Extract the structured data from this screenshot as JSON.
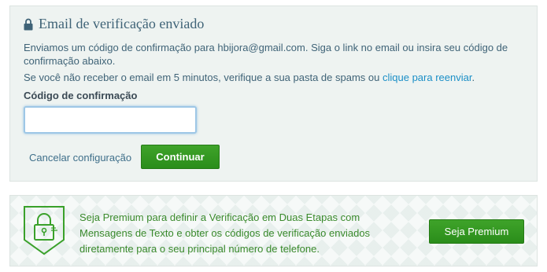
{
  "verify": {
    "title": "Email de verificação enviado",
    "message_line1": "Enviamos um código de confirmação para hbijora@gmail.com. Siga o link no email ou insira seu código de confirmação abaixo.",
    "message_line2_prefix": "Se você não receber o email em 5 minutos, verifique a sua pasta de spams ou ",
    "resend_link": "clique para reenviar",
    "message_line2_suffix": ".",
    "code_label": "Código de confirmação",
    "code_value": "",
    "code_placeholder": "",
    "cancel_label": "Cancelar configuração",
    "continue_label": "Continuar"
  },
  "premium": {
    "text": "Seja Premium para definir a Verificação em Duas Etapas com Mensagens de Texto e obter os códigos de verificação enviados diretamente para o seu principal número de telefone.",
    "button_label": "Seja Premium",
    "icon": "shield-lock-icon"
  },
  "colors": {
    "accent_green": "#2f9720",
    "link_blue": "#1b8fc7",
    "title_color": "#3f6377"
  }
}
